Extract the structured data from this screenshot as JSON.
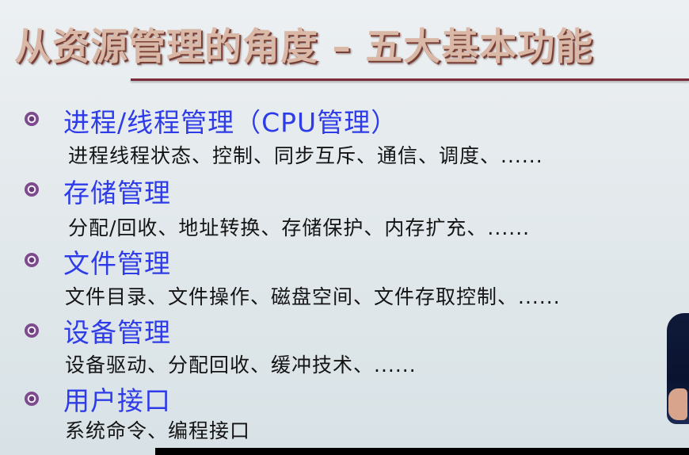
{
  "title": "从资源管理的角度 – 五大基本功能",
  "items": [
    {
      "heading": "进程/线程管理（CPU管理）",
      "detail": "进程线程状态、控制、同步互斥、通信、调度、......"
    },
    {
      "heading": "存储管理",
      "detail": "分配/回收、地址转换、存储保护、内存扩充、......"
    },
    {
      "heading": "文件管理",
      "detail": "文件目录、文件操作、磁盘空间、文件存取控制、......"
    },
    {
      "heading": "设备管理",
      "detail": "设备驱动、分配回收、缓冲技术、......"
    },
    {
      "heading": "用户接口",
      "detail": "系统命令、编程接口"
    }
  ]
}
